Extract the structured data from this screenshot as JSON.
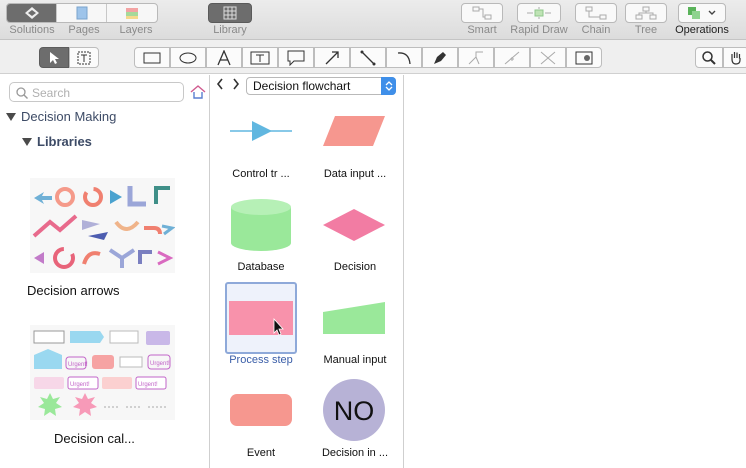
{
  "toolbar": {
    "view_buttons": [
      "Solutions",
      "Pages",
      "Layers"
    ],
    "library_label": "Library",
    "right_buttons": [
      "Smart",
      "Rapid Draw",
      "Chain",
      "Tree"
    ],
    "operations_label": "Operations"
  },
  "tools": [
    "select",
    "text-block",
    "rectangle",
    "ellipse",
    "text",
    "text-box",
    "callout",
    "arrow",
    "line",
    "arc",
    "pen",
    "smart-connect",
    "connect",
    "chain-connect",
    "insert",
    "zoom",
    "hand"
  ],
  "left_panel": {
    "search_placeholder": "Search",
    "tree_root": "Decision Making",
    "tree_child": "Libraries",
    "libraries": [
      {
        "name": "Decision arrows"
      },
      {
        "name": "Decision cal..."
      }
    ],
    "thumb_text": {
      "urgent1": "Urgent!",
      "urgent2": "Urgent!",
      "urgent3": "Urgent!",
      "urgent4": "Urgent!"
    }
  },
  "middle_panel": {
    "library_name": "Decision flowchart",
    "shapes": [
      {
        "label": "Control tr ..."
      },
      {
        "label": "Data input ..."
      },
      {
        "label": "Database"
      },
      {
        "label": "Decision"
      },
      {
        "label": "Process step"
      },
      {
        "label": "Manual input"
      },
      {
        "label": "Event"
      },
      {
        "label": "Decision in ..."
      }
    ],
    "no_text": "NO"
  },
  "colors": {
    "blue_shape": "#61b7e0",
    "pink": "#f6978f",
    "green": "#9ae89a",
    "magenta": "#f27ca3",
    "process_pink": "#f892ab",
    "lavender": "#b7b2d6",
    "selection": "#8ea9d9"
  }
}
